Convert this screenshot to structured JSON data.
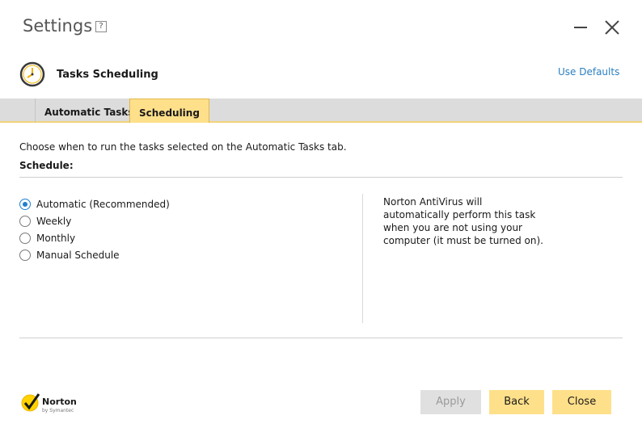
{
  "window": {
    "title": "Settings",
    "help_label": "?"
  },
  "section": {
    "icon": "clock-icon",
    "title": "Tasks Scheduling",
    "use_defaults": "Use Defaults"
  },
  "tabs": [
    {
      "label": "Automatic Tasks",
      "active": false
    },
    {
      "label": "Scheduling",
      "active": true
    }
  ],
  "content": {
    "description": "Choose when to run the tasks selected on the Automatic Tasks tab.",
    "schedule_label": "Schedule:",
    "options": [
      {
        "label": "Automatic (Recommended)",
        "selected": true
      },
      {
        "label": "Weekly",
        "selected": false
      },
      {
        "label": "Monthly",
        "selected": false
      },
      {
        "label": "Manual Schedule",
        "selected": false
      }
    ],
    "info_text": "Norton AntiVirus will automatically perform this task when you are not using your computer (it must be turned on)."
  },
  "footer": {
    "logo_name": "Norton",
    "logo_sub": "by Symantec",
    "apply_label": "Apply",
    "back_label": "Back",
    "close_label": "Close"
  },
  "colors": {
    "accent_yellow": "#ffe08a",
    "link_blue": "#2b7fc0",
    "radio_blue": "#1e7fd0"
  }
}
